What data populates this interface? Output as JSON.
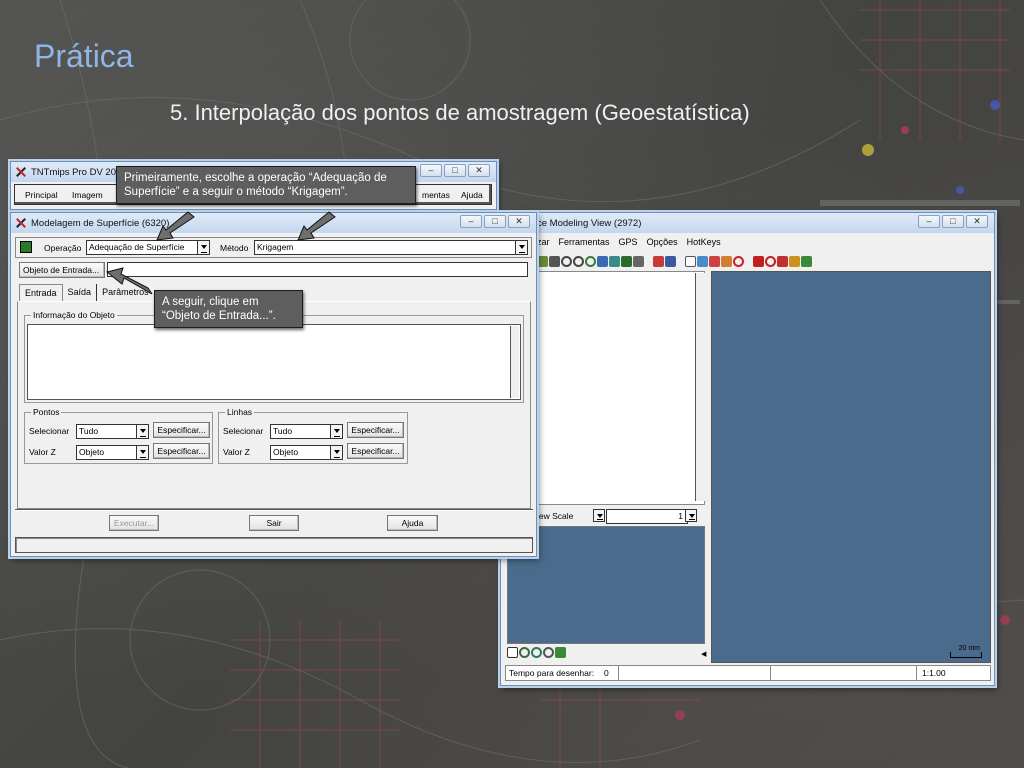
{
  "slide": {
    "title": "Prática",
    "subtitle": "5. Interpolação dos pontos de amostragem (Geoestatística)"
  },
  "main_window": {
    "title": "TNTmips Pro DV 201",
    "menu": [
      "Principal",
      "Imagem",
      "mentas",
      "Ajuda"
    ]
  },
  "surface_window": {
    "title": "Modelagem de Superfície (6320)",
    "operacao_label": "Operação",
    "operacao_value": "Adequação de Superfície",
    "metodo_label": "Método",
    "metodo_value": "Krigagem",
    "objeto_entrada_button": "Objeto de Entrada...",
    "tabs": [
      "Entrada",
      "Saída",
      "Parâmetros"
    ],
    "info_group_title": "Informação do Objeto",
    "pontos": {
      "title": "Pontos",
      "selecionar_label": "Selecionar",
      "selecionar_value": "Tudo",
      "valorz_label": "Valor Z",
      "valorz_value": "Objeto",
      "especificar": "Especificar..."
    },
    "linhas": {
      "title": "Linhas",
      "selecionar_label": "Selecionar",
      "selecionar_value": "Tudo",
      "valorz_label": "Valor Z",
      "valorz_value": "Objeto",
      "especificar": "Especificar..."
    },
    "executar": "Executar...",
    "sair": "Sair",
    "ajuda": "Ajuda"
  },
  "view_window": {
    "title": "ce Modeling View (2972)",
    "menu": [
      "zar",
      "Ferramentas",
      "GPS",
      "Opções",
      "HotKeys"
    ],
    "view_scale_label": "iew Scale",
    "scale_value": "1",
    "scale_bar": "20 mm",
    "status_label": "Tempo para desenhar:",
    "status_value": "0",
    "zoom_value": "1:1.00"
  },
  "callouts": {
    "first": "Primeiramente, escolhe a operação “Adequação de Superfície” e a seguir o método “Krigagem”.",
    "second": "A seguir, clique em “Objeto de Entrada...”."
  },
  "colors": {
    "title_blue": "#8fb6e8",
    "view_canvas": "#4a6b8c",
    "callout_bg": "#5e5e5e"
  }
}
